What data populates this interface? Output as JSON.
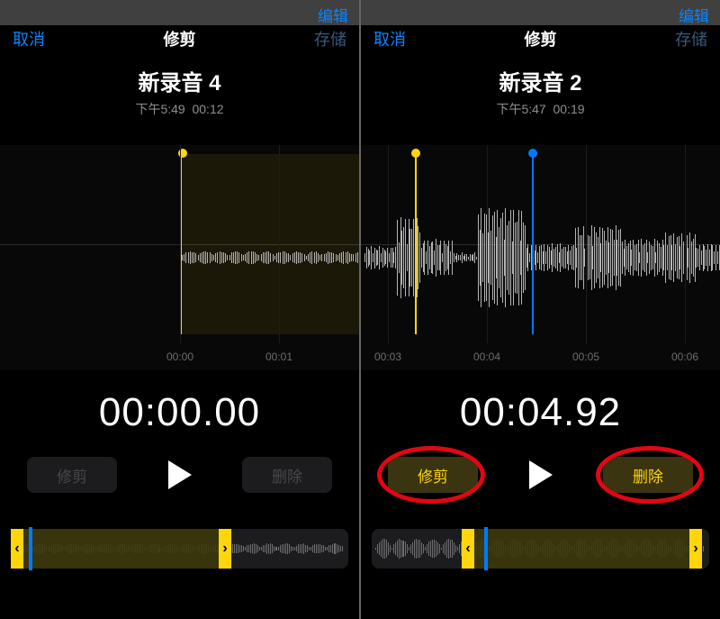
{
  "left": {
    "overlay_edit": "编辑",
    "nav": {
      "cancel": "取消",
      "title": "修剪",
      "save": "存储"
    },
    "recording": {
      "title": "新录音 4",
      "time": "下午5:49",
      "duration": "00:12"
    },
    "ticks": [
      "00:00",
      "00:01"
    ],
    "big_time": "00:00.00",
    "controls": {
      "trim": "修剪",
      "delete": "删除"
    }
  },
  "right": {
    "overlay_edit": "编辑",
    "nav": {
      "cancel": "取消",
      "title": "修剪",
      "save": "存储"
    },
    "recording": {
      "title": "新录音 2",
      "time": "下午5:47",
      "duration": "00:19"
    },
    "ticks": [
      "00:03",
      "00:04",
      "00:05",
      "00:06"
    ],
    "big_time": "00:04.92",
    "controls": {
      "trim": "修剪",
      "delete": "删除"
    }
  }
}
